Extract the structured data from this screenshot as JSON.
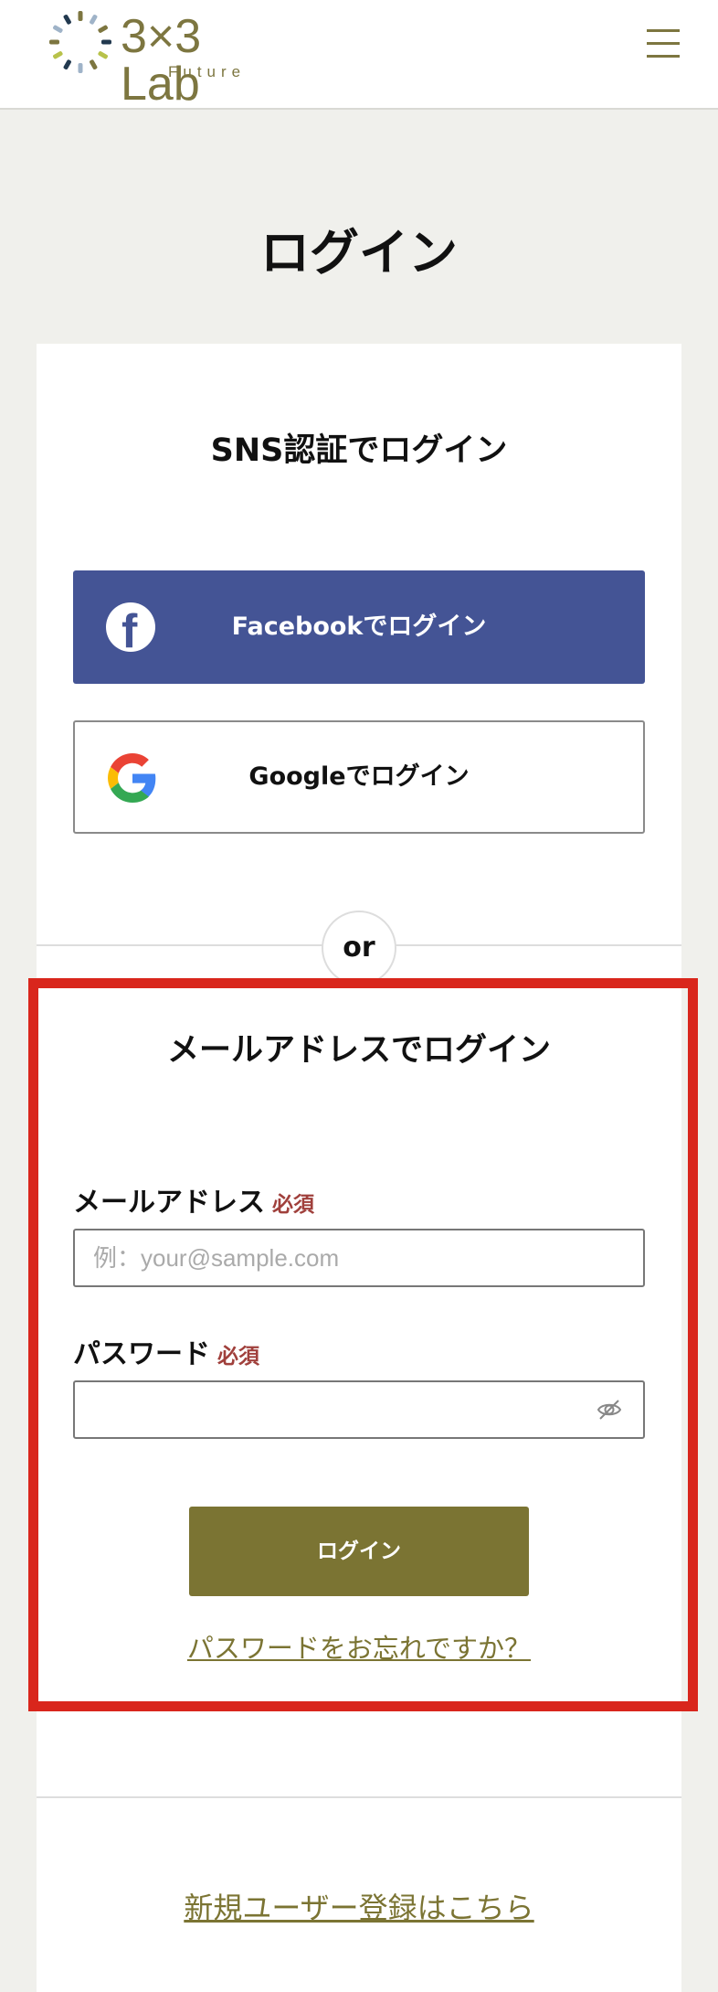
{
  "header": {
    "logo_text": "3×3 Lab",
    "logo_sub": "Future",
    "menu_icon": "hamburger-menu-icon"
  },
  "page": {
    "title": "ログイン"
  },
  "sns": {
    "title": "SNS認証でログイン",
    "facebook_label": "Facebookでログイン",
    "google_label": "Googleでログイン",
    "or_label": "or"
  },
  "email_login": {
    "title": "メールアドレスでログイン",
    "email_label": "メールアドレス",
    "email_required": "必須",
    "email_placeholder": "例：your@sample.com",
    "email_value": "",
    "password_label": "パスワード",
    "password_required": "必須",
    "password_value": "",
    "login_button": "ログイン",
    "forgot_link": "パスワードをお忘れですか？"
  },
  "register": {
    "link": "新規ユーザー登録はこちら"
  },
  "colors": {
    "brand": "#7b7433",
    "facebook": "#445495",
    "highlight": "#d9261c",
    "required": "#a0403c",
    "background": "#f0f0ec"
  }
}
